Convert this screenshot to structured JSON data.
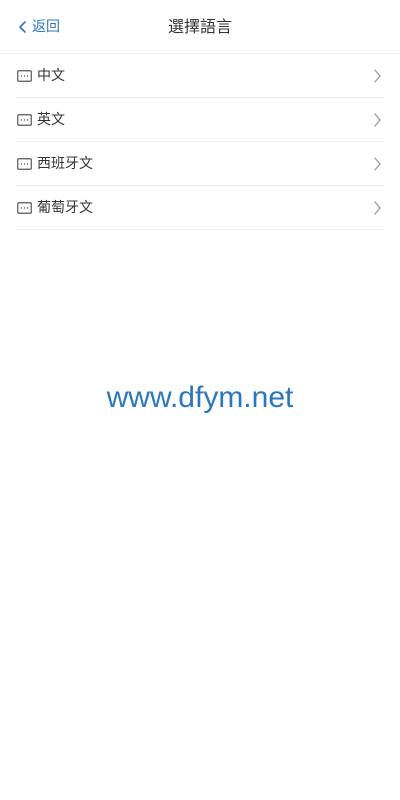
{
  "header": {
    "back_label": "返回",
    "title": "選擇語言"
  },
  "languages": [
    {
      "label": "中文"
    },
    {
      "label": "英文"
    },
    {
      "label": "西班牙文"
    },
    {
      "label": "葡萄牙文"
    }
  ],
  "watermark": "www.dfym.net",
  "colors": {
    "accent": "#2f78c4",
    "text": "#333333",
    "divider": "#eeeeee",
    "chevron": "#999999",
    "watermark": "#2b77be"
  },
  "icons": {
    "back": "chevron-left-icon",
    "item": "message-box-icon",
    "row_arrow": "chevron-right-icon"
  }
}
